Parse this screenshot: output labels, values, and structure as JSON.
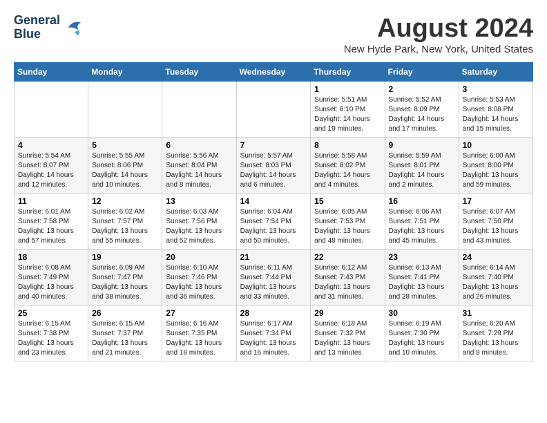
{
  "header": {
    "logo_line1": "General",
    "logo_line2": "Blue",
    "month": "August 2024",
    "location": "New Hyde Park, New York, United States"
  },
  "weekdays": [
    "Sunday",
    "Monday",
    "Tuesday",
    "Wednesday",
    "Thursday",
    "Friday",
    "Saturday"
  ],
  "weeks": [
    [
      {
        "day": "",
        "info": ""
      },
      {
        "day": "",
        "info": ""
      },
      {
        "day": "",
        "info": ""
      },
      {
        "day": "",
        "info": ""
      },
      {
        "day": "1",
        "info": "Sunrise: 5:51 AM\nSunset: 8:10 PM\nDaylight: 14 hours\nand 19 minutes."
      },
      {
        "day": "2",
        "info": "Sunrise: 5:52 AM\nSunset: 8:09 PM\nDaylight: 14 hours\nand 17 minutes."
      },
      {
        "day": "3",
        "info": "Sunrise: 5:53 AM\nSunset: 8:08 PM\nDaylight: 14 hours\nand 15 minutes."
      }
    ],
    [
      {
        "day": "4",
        "info": "Sunrise: 5:54 AM\nSunset: 8:07 PM\nDaylight: 14 hours\nand 12 minutes."
      },
      {
        "day": "5",
        "info": "Sunrise: 5:55 AM\nSunset: 8:06 PM\nDaylight: 14 hours\nand 10 minutes."
      },
      {
        "day": "6",
        "info": "Sunrise: 5:56 AM\nSunset: 8:04 PM\nDaylight: 14 hours\nand 8 minutes."
      },
      {
        "day": "7",
        "info": "Sunrise: 5:57 AM\nSunset: 8:03 PM\nDaylight: 14 hours\nand 6 minutes."
      },
      {
        "day": "8",
        "info": "Sunrise: 5:58 AM\nSunset: 8:02 PM\nDaylight: 14 hours\nand 4 minutes."
      },
      {
        "day": "9",
        "info": "Sunrise: 5:59 AM\nSunset: 8:01 PM\nDaylight: 14 hours\nand 2 minutes."
      },
      {
        "day": "10",
        "info": "Sunrise: 6:00 AM\nSunset: 8:00 PM\nDaylight: 13 hours\nand 59 minutes."
      }
    ],
    [
      {
        "day": "11",
        "info": "Sunrise: 6:01 AM\nSunset: 7:58 PM\nDaylight: 13 hours\nand 57 minutes."
      },
      {
        "day": "12",
        "info": "Sunrise: 6:02 AM\nSunset: 7:57 PM\nDaylight: 13 hours\nand 55 minutes."
      },
      {
        "day": "13",
        "info": "Sunrise: 6:03 AM\nSunset: 7:56 PM\nDaylight: 13 hours\nand 52 minutes."
      },
      {
        "day": "14",
        "info": "Sunrise: 6:04 AM\nSunset: 7:54 PM\nDaylight: 13 hours\nand 50 minutes."
      },
      {
        "day": "15",
        "info": "Sunrise: 6:05 AM\nSunset: 7:53 PM\nDaylight: 13 hours\nand 48 minutes."
      },
      {
        "day": "16",
        "info": "Sunrise: 6:06 AM\nSunset: 7:51 PM\nDaylight: 13 hours\nand 45 minutes."
      },
      {
        "day": "17",
        "info": "Sunrise: 6:07 AM\nSunset: 7:50 PM\nDaylight: 13 hours\nand 43 minutes."
      }
    ],
    [
      {
        "day": "18",
        "info": "Sunrise: 6:08 AM\nSunset: 7:49 PM\nDaylight: 13 hours\nand 40 minutes."
      },
      {
        "day": "19",
        "info": "Sunrise: 6:09 AM\nSunset: 7:47 PM\nDaylight: 13 hours\nand 38 minutes."
      },
      {
        "day": "20",
        "info": "Sunrise: 6:10 AM\nSunset: 7:46 PM\nDaylight: 13 hours\nand 36 minutes."
      },
      {
        "day": "21",
        "info": "Sunrise: 6:11 AM\nSunset: 7:44 PM\nDaylight: 13 hours\nand 33 minutes."
      },
      {
        "day": "22",
        "info": "Sunrise: 6:12 AM\nSunset: 7:43 PM\nDaylight: 13 hours\nand 31 minutes."
      },
      {
        "day": "23",
        "info": "Sunrise: 6:13 AM\nSunset: 7:41 PM\nDaylight: 13 hours\nand 28 minutes."
      },
      {
        "day": "24",
        "info": "Sunrise: 6:14 AM\nSunset: 7:40 PM\nDaylight: 13 hours\nand 26 minutes."
      }
    ],
    [
      {
        "day": "25",
        "info": "Sunrise: 6:15 AM\nSunset: 7:38 PM\nDaylight: 13 hours\nand 23 minutes."
      },
      {
        "day": "26",
        "info": "Sunrise: 6:15 AM\nSunset: 7:37 PM\nDaylight: 13 hours\nand 21 minutes."
      },
      {
        "day": "27",
        "info": "Sunrise: 6:16 AM\nSunset: 7:35 PM\nDaylight: 13 hours\nand 18 minutes."
      },
      {
        "day": "28",
        "info": "Sunrise: 6:17 AM\nSunset: 7:34 PM\nDaylight: 13 hours\nand 16 minutes."
      },
      {
        "day": "29",
        "info": "Sunrise: 6:18 AM\nSunset: 7:32 PM\nDaylight: 13 hours\nand 13 minutes."
      },
      {
        "day": "30",
        "info": "Sunrise: 6:19 AM\nSunset: 7:30 PM\nDaylight: 13 hours\nand 10 minutes."
      },
      {
        "day": "31",
        "info": "Sunrise: 6:20 AM\nSunset: 7:29 PM\nDaylight: 13 hours\nand 8 minutes."
      }
    ]
  ]
}
